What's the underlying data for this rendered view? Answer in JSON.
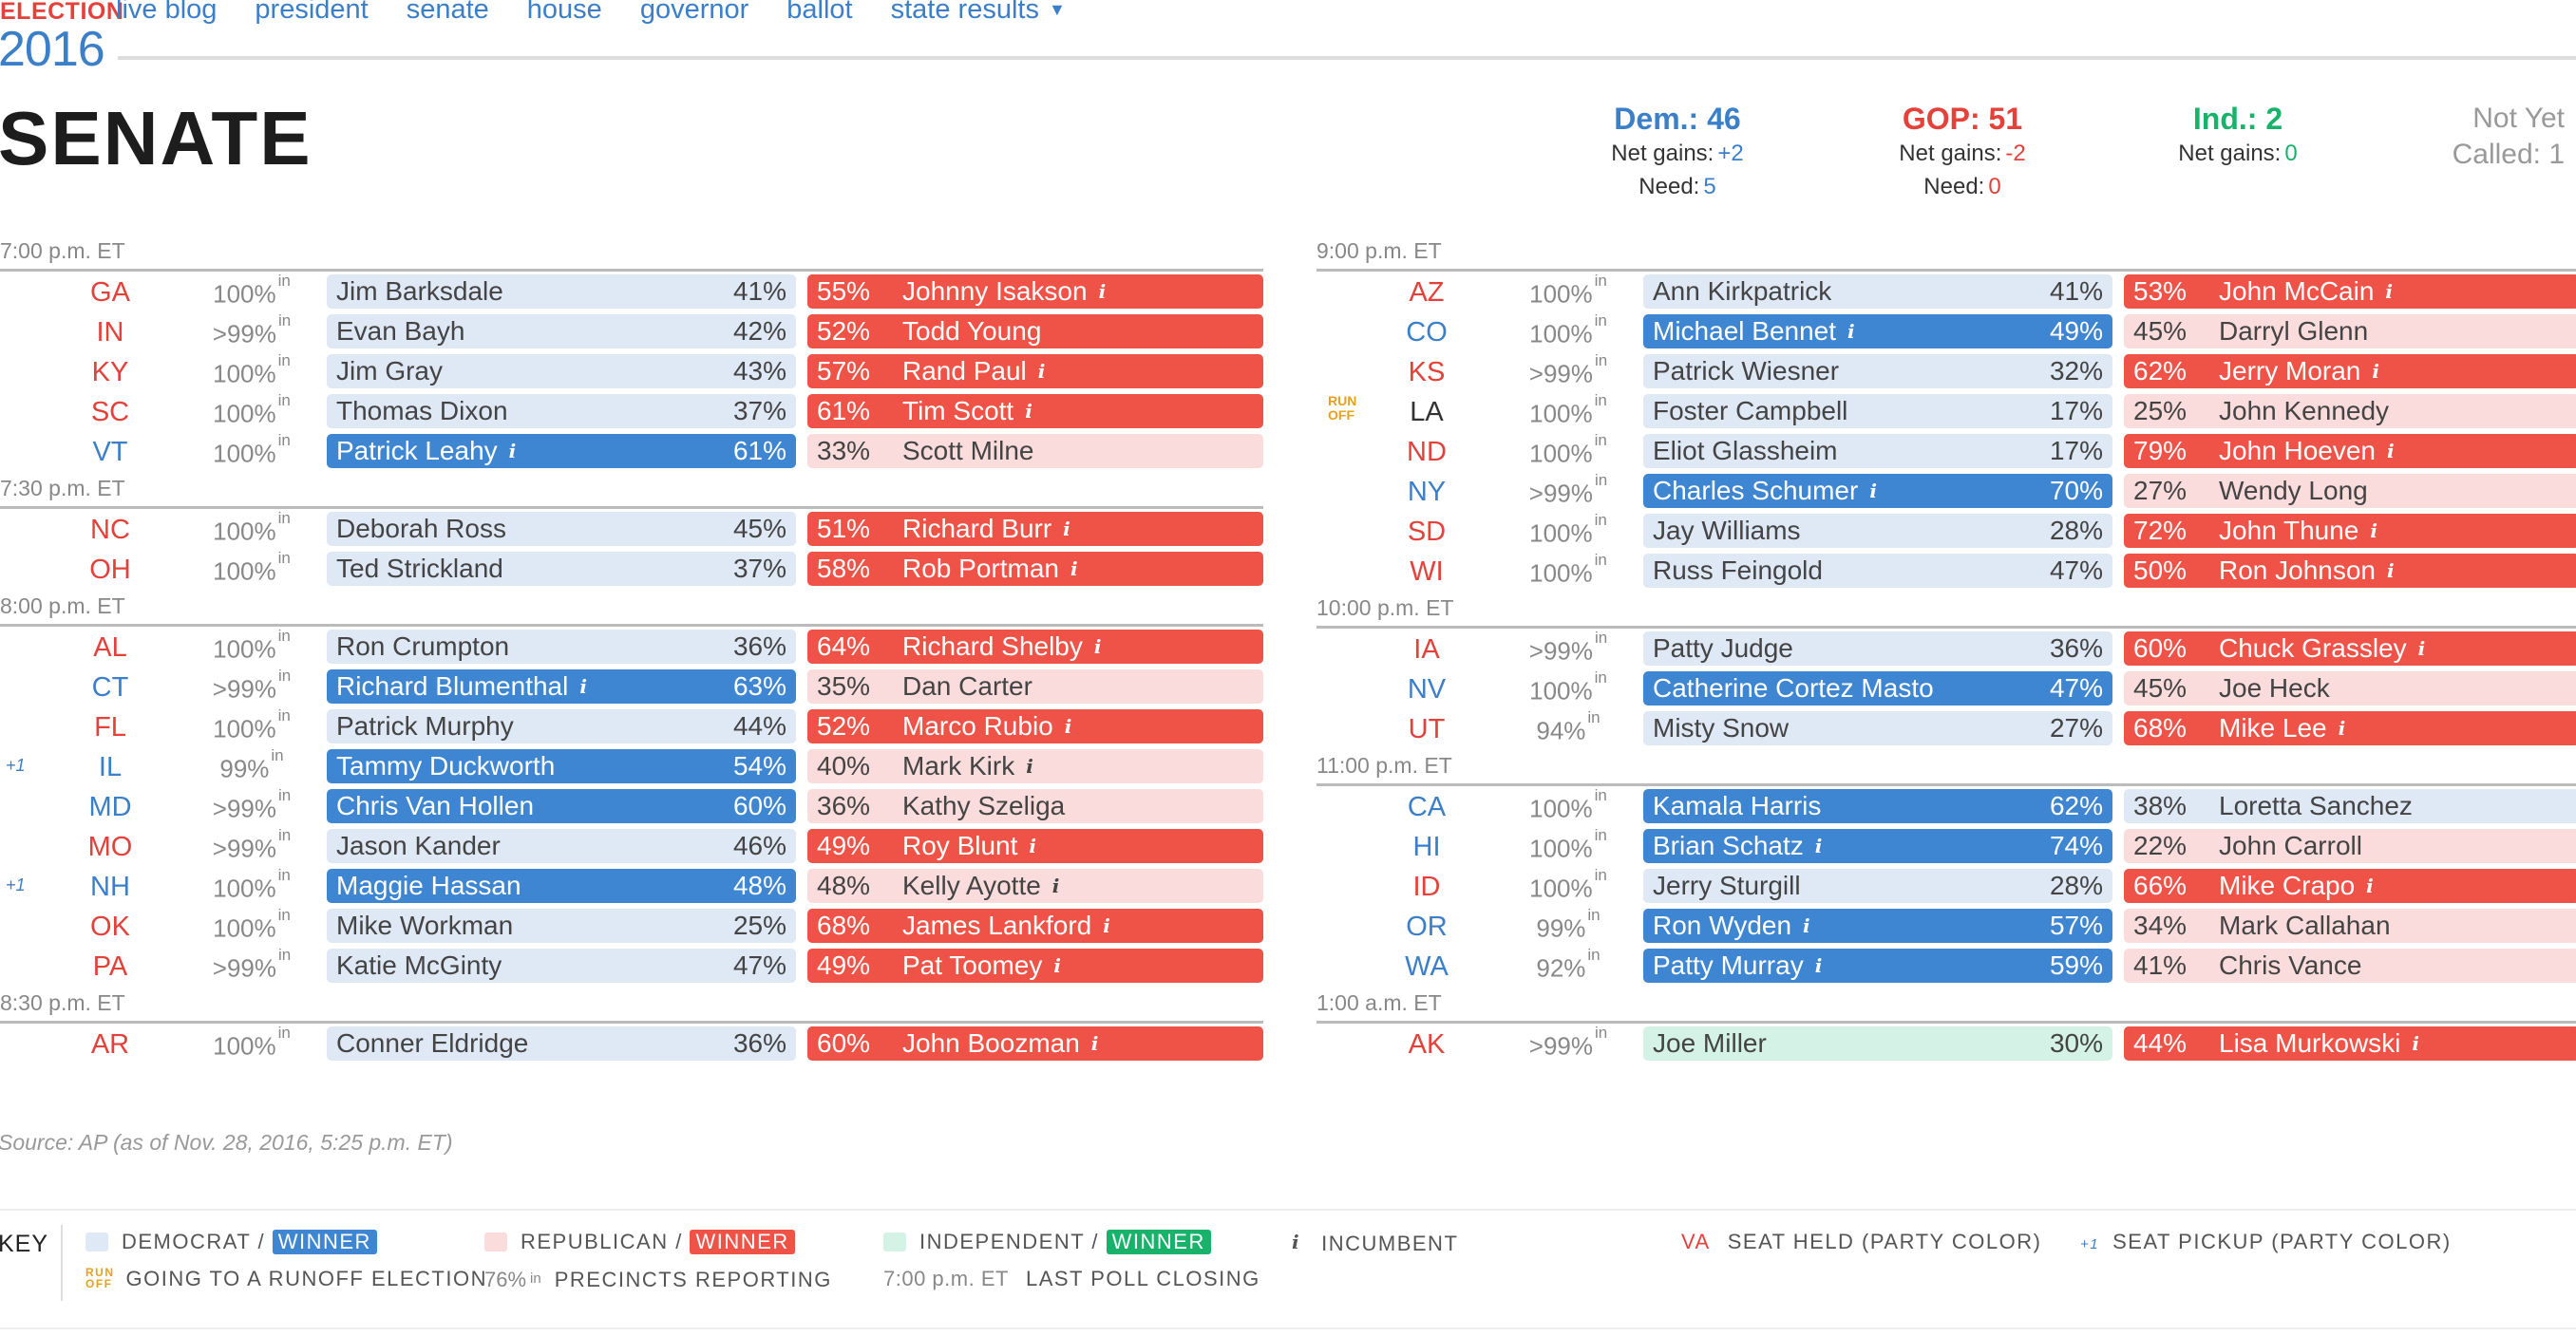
{
  "nav": {
    "logo_top": "ELECTION",
    "logo_year": "2016",
    "links": [
      "live blog",
      "president",
      "senate",
      "house",
      "governor",
      "ballot",
      "state results"
    ],
    "dropdown_icon": "▼"
  },
  "title": "SENATE",
  "tally": {
    "dem": {
      "label": "Dem.: 46",
      "net_label": "Net gains:",
      "net_value": "+2",
      "need_label": "Need:",
      "need_value": "5"
    },
    "gop": {
      "label": "GOP: 51",
      "net_label": "Net gains:",
      "net_value": "-2",
      "need_label": "Need:",
      "need_value": "0"
    },
    "ind": {
      "label": "Ind.: 2",
      "net_label": "Net gains:",
      "net_value": "0"
    },
    "not_called": {
      "line1": "Not Yet",
      "line2": "Called: 1"
    }
  },
  "colors": {
    "dem": "#3e86d1",
    "dem_light": "#dfe8f5",
    "gop": "#ef5347",
    "gop_light": "#fbdcdc",
    "ind": "#19b26b",
    "ind_light": "#d4f3e6",
    "runoff": "#e6a21d"
  },
  "left_groups": [
    {
      "time": "7:00 p.m. ET",
      "rows": [
        {
          "state": "GA",
          "held": "R",
          "pct": "100%",
          "in": "in",
          "a": {
            "name": "Jim Barksdale",
            "pct": "41%",
            "style": "ld"
          },
          "b": {
            "name": "Johnny Isakson",
            "pct": "55%",
            "style": "R",
            "inc": true
          }
        },
        {
          "state": "IN",
          "held": "R",
          "pct": ">99%",
          "in": "in",
          "a": {
            "name": "Evan Bayh",
            "pct": "42%",
            "style": "ld"
          },
          "b": {
            "name": "Todd Young",
            "pct": "52%",
            "style": "R"
          }
        },
        {
          "state": "KY",
          "held": "R",
          "pct": "100%",
          "in": "in",
          "a": {
            "name": "Jim Gray",
            "pct": "43%",
            "style": "ld"
          },
          "b": {
            "name": "Rand Paul",
            "pct": "57%",
            "style": "R",
            "inc": true
          }
        },
        {
          "state": "SC",
          "held": "R",
          "pct": "100%",
          "in": "in",
          "a": {
            "name": "Thomas Dixon",
            "pct": "37%",
            "style": "ld"
          },
          "b": {
            "name": "Tim Scott",
            "pct": "61%",
            "style": "R",
            "inc": true
          }
        },
        {
          "state": "VT",
          "held": "D",
          "pct": "100%",
          "in": "in",
          "a": {
            "name": "Patrick Leahy",
            "pct": "61%",
            "style": "D",
            "inc": true
          },
          "b": {
            "name": "Scott Milne",
            "pct": "33%",
            "style": "lr"
          }
        }
      ]
    },
    {
      "time": "7:30 p.m. ET",
      "rows": [
        {
          "state": "NC",
          "held": "R",
          "pct": "100%",
          "in": "in",
          "a": {
            "name": "Deborah Ross",
            "pct": "45%",
            "style": "ld"
          },
          "b": {
            "name": "Richard Burr",
            "pct": "51%",
            "style": "R",
            "inc": true
          }
        },
        {
          "state": "OH",
          "held": "R",
          "pct": "100%",
          "in": "in",
          "a": {
            "name": "Ted Strickland",
            "pct": "37%",
            "style": "ld"
          },
          "b": {
            "name": "Rob Portman",
            "pct": "58%",
            "style": "R",
            "inc": true
          }
        }
      ]
    },
    {
      "time": "8:00 p.m. ET",
      "rows": [
        {
          "state": "AL",
          "held": "R",
          "pct": "100%",
          "in": "in",
          "a": {
            "name": "Ron Crumpton",
            "pct": "36%",
            "style": "ld"
          },
          "b": {
            "name": "Richard Shelby",
            "pct": "64%",
            "style": "R",
            "inc": true
          }
        },
        {
          "state": "CT",
          "held": "D",
          "pct": ">99%",
          "in": "in",
          "a": {
            "name": "Richard Blumenthal",
            "pct": "63%",
            "style": "D",
            "inc": true
          },
          "b": {
            "name": "Dan Carter",
            "pct": "35%",
            "style": "lr"
          }
        },
        {
          "state": "FL",
          "held": "R",
          "pct": "100%",
          "in": "in",
          "a": {
            "name": "Patrick Murphy",
            "pct": "44%",
            "style": "ld"
          },
          "b": {
            "name": "Marco Rubio",
            "pct": "52%",
            "style": "R",
            "inc": true
          }
        },
        {
          "state": "IL",
          "held": "D",
          "pickup": "+1",
          "pct": "99%",
          "in": "in",
          "a": {
            "name": "Tammy Duckworth",
            "pct": "54%",
            "style": "D"
          },
          "b": {
            "name": "Mark Kirk",
            "pct": "40%",
            "style": "lr",
            "inc": true
          }
        },
        {
          "state": "MD",
          "held": "D",
          "pct": ">99%",
          "in": "in",
          "a": {
            "name": "Chris Van Hollen",
            "pct": "60%",
            "style": "D"
          },
          "b": {
            "name": "Kathy Szeliga",
            "pct": "36%",
            "style": "lr"
          }
        },
        {
          "state": "MO",
          "held": "R",
          "pct": ">99%",
          "in": "in",
          "a": {
            "name": "Jason Kander",
            "pct": "46%",
            "style": "ld"
          },
          "b": {
            "name": "Roy Blunt",
            "pct": "49%",
            "style": "R",
            "inc": true
          }
        },
        {
          "state": "NH",
          "held": "D",
          "pickup": "+1",
          "pct": "100%",
          "in": "in",
          "a": {
            "name": "Maggie Hassan",
            "pct": "48%",
            "style": "D"
          },
          "b": {
            "name": "Kelly Ayotte",
            "pct": "48%",
            "style": "lr",
            "inc": true
          }
        },
        {
          "state": "OK",
          "held": "R",
          "pct": "100%",
          "in": "in",
          "a": {
            "name": "Mike Workman",
            "pct": "25%",
            "style": "ld"
          },
          "b": {
            "name": "James Lankford",
            "pct": "68%",
            "style": "R",
            "inc": true
          }
        },
        {
          "state": "PA",
          "held": "R",
          "pct": ">99%",
          "in": "in",
          "a": {
            "name": "Katie McGinty",
            "pct": "47%",
            "style": "ld"
          },
          "b": {
            "name": "Pat Toomey",
            "pct": "49%",
            "style": "R",
            "inc": true
          }
        }
      ]
    },
    {
      "time": "8:30 p.m. ET",
      "rows": [
        {
          "state": "AR",
          "held": "R",
          "pct": "100%",
          "in": "in",
          "a": {
            "name": "Conner Eldridge",
            "pct": "36%",
            "style": "ld"
          },
          "b": {
            "name": "John Boozman",
            "pct": "60%",
            "style": "R",
            "inc": true
          }
        }
      ]
    }
  ],
  "right_groups": [
    {
      "time": "9:00 p.m. ET",
      "rows": [
        {
          "state": "AZ",
          "held": "R",
          "pct": "100%",
          "in": "in",
          "a": {
            "name": "Ann Kirkpatrick",
            "pct": "41%",
            "style": "ld"
          },
          "b": {
            "name": "John McCain",
            "pct": "53%",
            "style": "R",
            "inc": true
          }
        },
        {
          "state": "CO",
          "held": "D",
          "pct": "100%",
          "in": "in",
          "a": {
            "name": "Michael Bennet",
            "pct": "49%",
            "style": "D",
            "inc": true
          },
          "b": {
            "name": "Darryl Glenn",
            "pct": "45%",
            "style": "lr"
          }
        },
        {
          "state": "KS",
          "held": "R",
          "pct": ">99%",
          "in": "in",
          "a": {
            "name": "Patrick Wiesner",
            "pct": "32%",
            "style": "ld"
          },
          "b": {
            "name": "Jerry Moran",
            "pct": "62%",
            "style": "R",
            "inc": true
          }
        },
        {
          "state": "LA",
          "held": "N",
          "runoff": "RUN\nOFF",
          "pct": "100%",
          "in": "in",
          "a": {
            "name": "Foster Campbell",
            "pct": "17%",
            "style": "ld"
          },
          "b": {
            "name": "John Kennedy",
            "pct": "25%",
            "style": "lr"
          }
        },
        {
          "state": "ND",
          "held": "R",
          "pct": "100%",
          "in": "in",
          "a": {
            "name": "Eliot Glassheim",
            "pct": "17%",
            "style": "ld"
          },
          "b": {
            "name": "John Hoeven",
            "pct": "79%",
            "style": "R",
            "inc": true
          }
        },
        {
          "state": "NY",
          "held": "D",
          "pct": ">99%",
          "in": "in",
          "a": {
            "name": "Charles Schumer",
            "pct": "70%",
            "style": "D",
            "inc": true
          },
          "b": {
            "name": "Wendy Long",
            "pct": "27%",
            "style": "lr"
          }
        },
        {
          "state": "SD",
          "held": "R",
          "pct": "100%",
          "in": "in",
          "a": {
            "name": "Jay Williams",
            "pct": "28%",
            "style": "ld"
          },
          "b": {
            "name": "John Thune",
            "pct": "72%",
            "style": "R",
            "inc": true
          }
        },
        {
          "state": "WI",
          "held": "R",
          "pct": "100%",
          "in": "in",
          "a": {
            "name": "Russ Feingold",
            "pct": "47%",
            "style": "ld"
          },
          "b": {
            "name": "Ron Johnson",
            "pct": "50%",
            "style": "R",
            "inc": true
          }
        }
      ]
    },
    {
      "time": "10:00 p.m. ET",
      "rows": [
        {
          "state": "IA",
          "held": "R",
          "pct": ">99%",
          "in": "in",
          "a": {
            "name": "Patty Judge",
            "pct": "36%",
            "style": "ld"
          },
          "b": {
            "name": "Chuck Grassley",
            "pct": "60%",
            "style": "R",
            "inc": true
          }
        },
        {
          "state": "NV",
          "held": "D",
          "pct": "100%",
          "in": "in",
          "a": {
            "name": "Catherine Cortez Masto",
            "pct": "47%",
            "style": "D"
          },
          "b": {
            "name": "Joe Heck",
            "pct": "45%",
            "style": "lr"
          }
        },
        {
          "state": "UT",
          "held": "R",
          "pct": "94%",
          "in": "in",
          "a": {
            "name": "Misty Snow",
            "pct": "27%",
            "style": "ld"
          },
          "b": {
            "name": "Mike Lee",
            "pct": "68%",
            "style": "R",
            "inc": true
          }
        }
      ]
    },
    {
      "time": "11:00 p.m. ET",
      "rows": [
        {
          "state": "CA",
          "held": "D",
          "pct": "100%",
          "in": "in",
          "a": {
            "name": "Kamala Harris",
            "pct": "62%",
            "style": "D"
          },
          "b": {
            "name": "Loretta Sanchez",
            "pct": "38%",
            "style": "ld"
          }
        },
        {
          "state": "HI",
          "held": "D",
          "pct": "100%",
          "in": "in",
          "a": {
            "name": "Brian Schatz",
            "pct": "74%",
            "style": "D",
            "inc": true
          },
          "b": {
            "name": "John Carroll",
            "pct": "22%",
            "style": "lr"
          }
        },
        {
          "state": "ID",
          "held": "R",
          "pct": "100%",
          "in": "in",
          "a": {
            "name": "Jerry Sturgill",
            "pct": "28%",
            "style": "ld"
          },
          "b": {
            "name": "Mike Crapo",
            "pct": "66%",
            "style": "R",
            "inc": true
          }
        },
        {
          "state": "OR",
          "held": "D",
          "pct": "99%",
          "in": "in",
          "a": {
            "name": "Ron Wyden",
            "pct": "57%",
            "style": "D",
            "inc": true
          },
          "b": {
            "name": "Mark Callahan",
            "pct": "34%",
            "style": "lr"
          }
        },
        {
          "state": "WA",
          "held": "D",
          "pct": "92%",
          "in": "in",
          "a": {
            "name": "Patty Murray",
            "pct": "59%",
            "style": "D",
            "inc": true
          },
          "b": {
            "name": "Chris Vance",
            "pct": "41%",
            "style": "lr"
          }
        }
      ]
    },
    {
      "time": "1:00 a.m. ET",
      "rows": [
        {
          "state": "AK",
          "held": "R",
          "pct": ">99%",
          "in": "in",
          "a": {
            "name": "Joe Miller",
            "pct": "30%",
            "style": "li"
          },
          "b": {
            "name": "Lisa Murkowski",
            "pct": "44%",
            "style": "R",
            "inc": true
          }
        }
      ]
    }
  ],
  "incumbent_icon": "i",
  "source": "Source: AP (as of Nov. 28, 2016, 5:25 p.m. ET)",
  "key": {
    "label": "KEY",
    "dem": "DEMOCRAT /",
    "rep": "REPUBLICAN /",
    "ind": "INDEPENDENT /",
    "winner": "WINNER",
    "incumbent_icon": "i",
    "incumbent": "INCUMBENT",
    "seat_held_state": "VA",
    "seat_held": "SEAT HELD (PARTY COLOR)",
    "pickup_sample": "+1",
    "pickup": "SEAT PICKUP (PARTY COLOR)",
    "runoff_glyph": "RUN\nOFF",
    "runoff": "GOING TO A RUNOFF ELECTION",
    "precincts_sample": "76%",
    "precincts_in": "in",
    "precincts": "PRECINCTS REPORTING",
    "poll_sample": "7:00 p.m. ET",
    "poll": "LAST POLL CLOSING"
  }
}
